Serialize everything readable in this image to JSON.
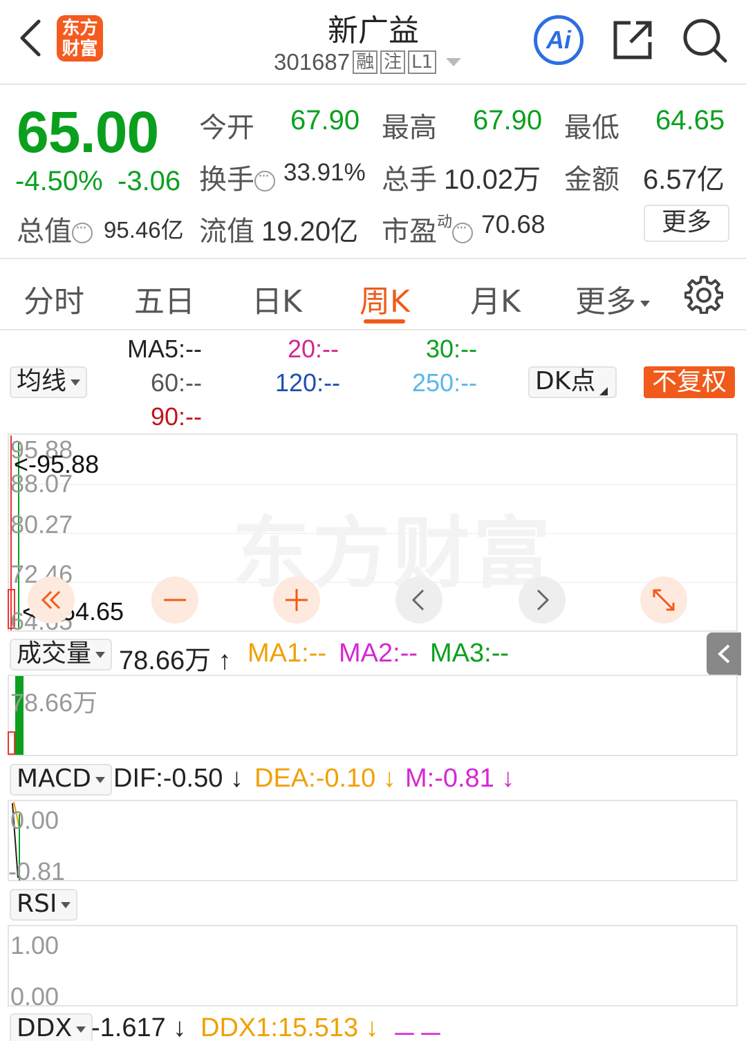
{
  "header": {
    "logo_line1": "东方",
    "logo_line2": "财富",
    "stock_name": "新广益",
    "stock_code": "301687",
    "tags": [
      "融",
      "注",
      "L1"
    ],
    "ai_label": "Ai"
  },
  "quote": {
    "price": "65.00",
    "change_pct": "-4.50%",
    "change_abs": "-3.06",
    "open_label": "今开",
    "open_value": "67.90",
    "high_label": "最高",
    "high_value": "67.90",
    "low_label": "最低",
    "low_value": "64.65",
    "turnover_label": "换手",
    "turnover_value": "33.91%",
    "volume_label": "总手",
    "volume_value": "10.02万",
    "amount_label": "金额",
    "amount_value": "6.57亿",
    "mcap_label": "总值",
    "mcap_value": "95.46亿",
    "float_label": "流值",
    "float_value": "19.20亿",
    "pe_label": "市盈",
    "pe_sup": "动",
    "pe_value": "70.68",
    "more_label": "更多"
  },
  "tabs": {
    "items": [
      "分时",
      "五日",
      "日K",
      "周K",
      "月K"
    ],
    "active": "周K",
    "more_label": "更多"
  },
  "ma": {
    "dropdown_label": "均线",
    "ma5": "MA5:--",
    "ma20": "20:--",
    "ma30": "30:--",
    "ma60": "60:--",
    "ma120": "120:--",
    "ma250": "250:--",
    "ma90": "90:--",
    "dk_label": "DK点",
    "fq_label": "不复权"
  },
  "kline": {
    "axis": [
      "95.88",
      "88.07",
      "80.27",
      "72.46",
      "64.65"
    ],
    "high_marker": "<-95.88",
    "low_marker": "<---64.65",
    "watermark": "东方财富"
  },
  "volume": {
    "dropdown_label": "成交量",
    "value": "78.66万",
    "ma1": "MA1:--",
    "ma2": "MA2:--",
    "ma3": "MA3:--",
    "axis_top": "78.66万"
  },
  "macd": {
    "dropdown_label": "MACD",
    "dif": "DIF:-0.50",
    "dea": "DEA:-0.10",
    "m": "M:-0.81",
    "axis_top": "0.00",
    "axis_bottom": "-0.81"
  },
  "rsi": {
    "dropdown_label": "RSI",
    "axis_top": "1.00",
    "axis_bottom": "0.00"
  },
  "ddx": {
    "dropdown_label": "DDX",
    "ddx": "-1.617",
    "ddx1": "DDX1:15.513",
    "dash": "－－"
  },
  "colors": {
    "down_green": "#0aa01e",
    "accent_orange": "#f05a1a",
    "ma20": "#d0288f",
    "ma30": "#0aa01e",
    "ma120": "#1f4fb0",
    "ma250": "#58b8e8",
    "ma90": "#c0141e"
  }
}
